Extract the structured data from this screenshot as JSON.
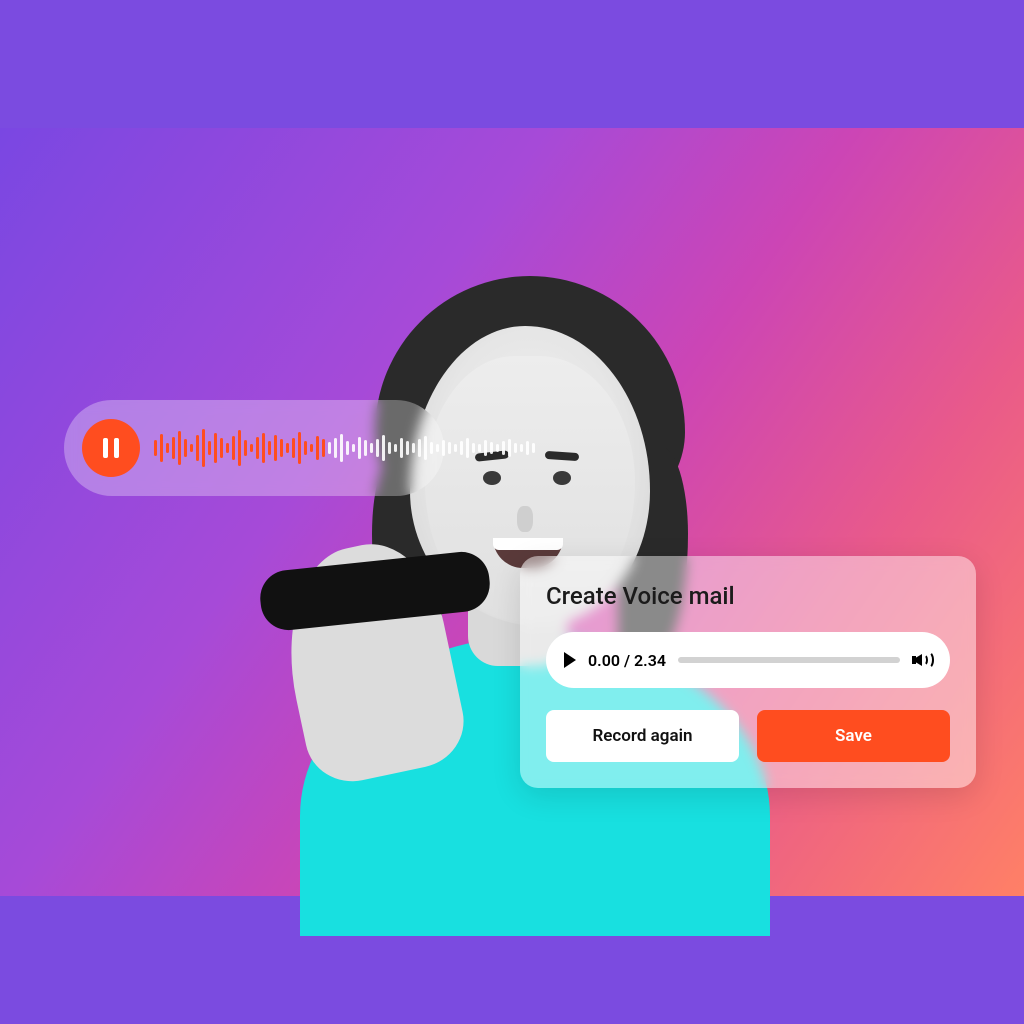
{
  "colors": {
    "accent": "#ff4d1f"
  },
  "voice_pill": {
    "state_icon": "pause-icon"
  },
  "card": {
    "title": "Create Voice mail",
    "player": {
      "current_time": "0.00",
      "duration": "2.34"
    },
    "record_again_label": "Record again",
    "save_label": "Save"
  },
  "waveform_bars": [
    16,
    28,
    10,
    22,
    34,
    18,
    8,
    26,
    38,
    14,
    30,
    20,
    10,
    24,
    36,
    16,
    8,
    22,
    30,
    14,
    26,
    18,
    10,
    20,
    32,
    14,
    8,
    24,
    18,
    12,
    20,
    28,
    14,
    8,
    22,
    16,
    10,
    18,
    26,
    12,
    8,
    20,
    14,
    10,
    18,
    24,
    12,
    8,
    16,
    12,
    8,
    14,
    20,
    10,
    8,
    16,
    12,
    8,
    14,
    18,
    10,
    8,
    14,
    10
  ]
}
